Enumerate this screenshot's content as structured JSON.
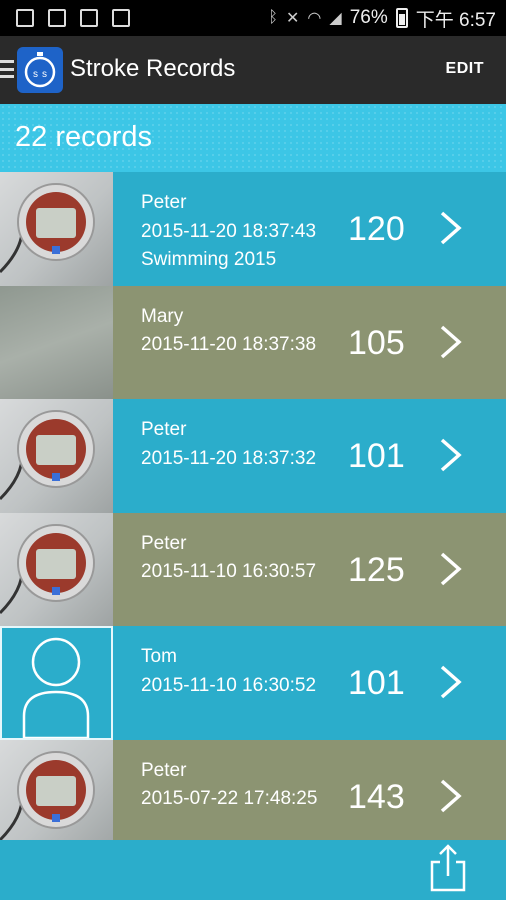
{
  "status_bar": {
    "battery": "76%",
    "time": "下午 6:57",
    "icons": [
      "notification-icon",
      "image-icon",
      "cast-icon",
      "briefcase-icon",
      "bluetooth-icon",
      "mute-icon",
      "wifi-icon",
      "signal-icon",
      "battery-icon"
    ]
  },
  "app_bar": {
    "title": "Stroke Records",
    "edit_label": "EDIT",
    "accent": "#1e63c8"
  },
  "header": {
    "record_count": "22 records"
  },
  "records": [
    {
      "name": "Peter",
      "datetime": "2015-11-20 18:37:43",
      "note": "Swimming 2015",
      "score": "120",
      "thumb": "stopwatch-photo",
      "bg": "blue"
    },
    {
      "name": "Mary",
      "datetime": "2015-11-20 18:37:38",
      "note": "",
      "score": "105",
      "thumb": "blurred-photo",
      "bg": "olive"
    },
    {
      "name": "Peter",
      "datetime": "2015-11-20 18:37:32",
      "note": "",
      "score": "101",
      "thumb": "stopwatch-photo",
      "bg": "blue"
    },
    {
      "name": "Peter",
      "datetime": "2015-11-10 16:30:57",
      "note": "",
      "score": "125",
      "thumb": "stopwatch-photo",
      "bg": "olive"
    },
    {
      "name": "Tom",
      "datetime": "2015-11-10 16:30:52",
      "note": "",
      "score": "101",
      "thumb": "default-avatar",
      "bg": "blue"
    },
    {
      "name": "Peter",
      "datetime": "2015-07-22 17:48:25",
      "note": "",
      "score": "143",
      "thumb": "stopwatch-photo",
      "bg": "olive"
    }
  ],
  "colors": {
    "row_blue": "#2badcb",
    "row_olive": "#8c9472",
    "header": "#3cc6e6",
    "app_bar": "#2a2a2a"
  }
}
